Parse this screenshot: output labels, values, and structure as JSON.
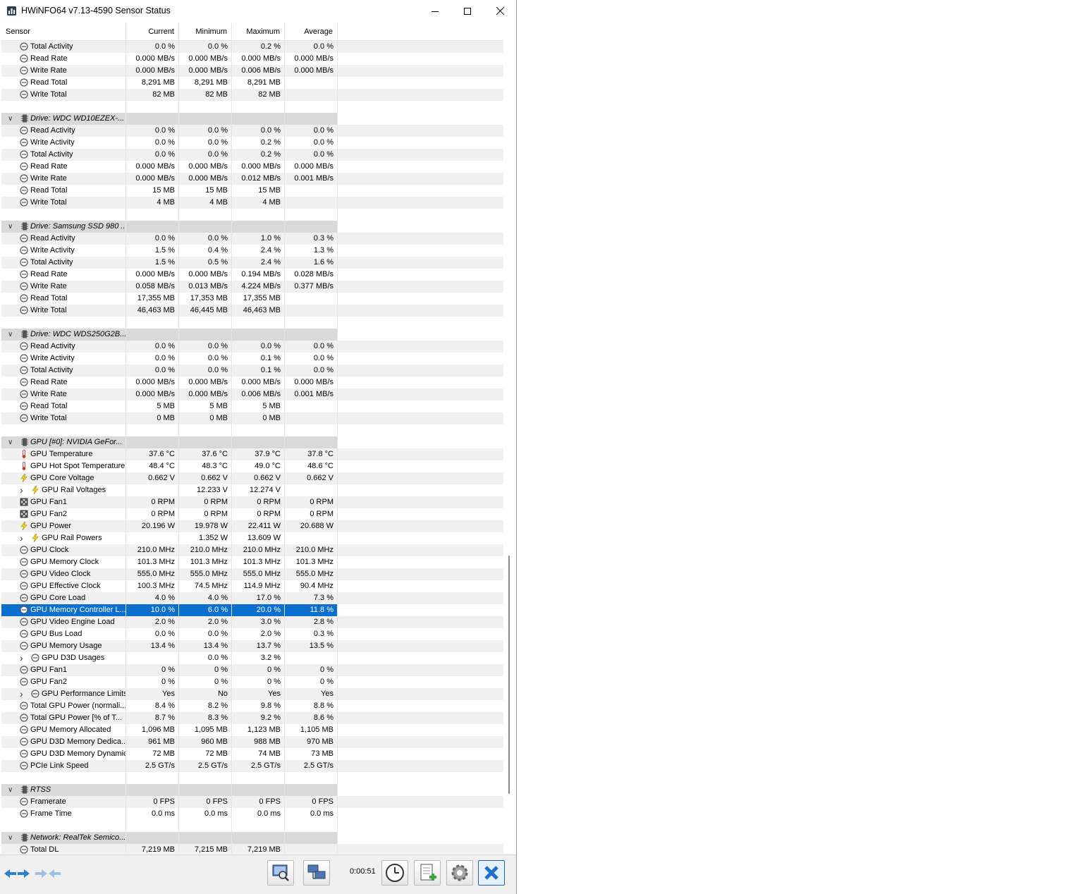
{
  "window": {
    "title": "HWiNFO64 v7.13-4590 Sensor Status"
  },
  "columns": [
    "Sensor",
    "Current",
    "Minimum",
    "Maximum",
    "Average"
  ],
  "rows": [
    {
      "t": "s",
      "i": "clock",
      "l": "Total Activity",
      "v": [
        "0.0 %",
        "0.0 %",
        "0.2 %",
        "0.0 %"
      ]
    },
    {
      "t": "s",
      "i": "clock",
      "l": "Read Rate",
      "v": [
        "0.000 MB/s",
        "0.000 MB/s",
        "0.000 MB/s",
        "0.000 MB/s"
      ]
    },
    {
      "t": "s",
      "i": "clock",
      "l": "Write Rate",
      "v": [
        "0.000 MB/s",
        "0.000 MB/s",
        "0.006 MB/s",
        "0.000 MB/s"
      ]
    },
    {
      "t": "s",
      "i": "clock",
      "l": "Read Total",
      "v": [
        "8,291 MB",
        "8,291 MB",
        "8,291 MB",
        ""
      ]
    },
    {
      "t": "s",
      "i": "clock",
      "l": "Write Total",
      "v": [
        "82 MB",
        "82 MB",
        "82 MB",
        ""
      ]
    },
    {
      "t": "b"
    },
    {
      "t": "g",
      "l": "Drive: WDC WD10EZEX-..."
    },
    {
      "t": "s",
      "i": "clock",
      "l": "Read Activity",
      "v": [
        "0.0 %",
        "0.0 %",
        "0.0 %",
        "0.0 %"
      ]
    },
    {
      "t": "s",
      "i": "clock",
      "l": "Write Activity",
      "v": [
        "0.0 %",
        "0.0 %",
        "0.2 %",
        "0.0 %"
      ]
    },
    {
      "t": "s",
      "i": "clock",
      "l": "Total Activity",
      "v": [
        "0.0 %",
        "0.0 %",
        "0.2 %",
        "0.0 %"
      ]
    },
    {
      "t": "s",
      "i": "clock",
      "l": "Read Rate",
      "v": [
        "0.000 MB/s",
        "0.000 MB/s",
        "0.000 MB/s",
        "0.000 MB/s"
      ]
    },
    {
      "t": "s",
      "i": "clock",
      "l": "Write Rate",
      "v": [
        "0.000 MB/s",
        "0.000 MB/s",
        "0.012 MB/s",
        "0.001 MB/s"
      ]
    },
    {
      "t": "s",
      "i": "clock",
      "l": "Read Total",
      "v": [
        "15 MB",
        "15 MB",
        "15 MB",
        ""
      ]
    },
    {
      "t": "s",
      "i": "clock",
      "l": "Write Total",
      "v": [
        "4 MB",
        "4 MB",
        "4 MB",
        ""
      ]
    },
    {
      "t": "b"
    },
    {
      "t": "g",
      "l": "Drive: Samsung SSD 980 ..."
    },
    {
      "t": "s",
      "i": "clock",
      "l": "Read Activity",
      "v": [
        "0.0 %",
        "0.0 %",
        "1.0 %",
        "0.3 %"
      ]
    },
    {
      "t": "s",
      "i": "clock",
      "l": "Write Activity",
      "v": [
        "1.5 %",
        "0.4 %",
        "2.4 %",
        "1.3 %"
      ]
    },
    {
      "t": "s",
      "i": "clock",
      "l": "Total Activity",
      "v": [
        "1.5 %",
        "0.5 %",
        "2.4 %",
        "1.6 %"
      ]
    },
    {
      "t": "s",
      "i": "clock",
      "l": "Read Rate",
      "v": [
        "0.000 MB/s",
        "0.000 MB/s",
        "0.194 MB/s",
        "0.028 MB/s"
      ]
    },
    {
      "t": "s",
      "i": "clock",
      "l": "Write Rate",
      "v": [
        "0.058 MB/s",
        "0.013 MB/s",
        "4.224 MB/s",
        "0.377 MB/s"
      ]
    },
    {
      "t": "s",
      "i": "clock",
      "l": "Read Total",
      "v": [
        "17,355 MB",
        "17,353 MB",
        "17,355 MB",
        ""
      ]
    },
    {
      "t": "s",
      "i": "clock",
      "l": "Write Total",
      "v": [
        "46,463 MB",
        "46,445 MB",
        "46,463 MB",
        ""
      ]
    },
    {
      "t": "b"
    },
    {
      "t": "g",
      "l": "Drive: WDC WDS250G2B..."
    },
    {
      "t": "s",
      "i": "clock",
      "l": "Read Activity",
      "v": [
        "0.0 %",
        "0.0 %",
        "0.0 %",
        "0.0 %"
      ]
    },
    {
      "t": "s",
      "i": "clock",
      "l": "Write Activity",
      "v": [
        "0.0 %",
        "0.0 %",
        "0.1 %",
        "0.0 %"
      ]
    },
    {
      "t": "s",
      "i": "clock",
      "l": "Total Activity",
      "v": [
        "0.0 %",
        "0.0 %",
        "0.1 %",
        "0.0 %"
      ]
    },
    {
      "t": "s",
      "i": "clock",
      "l": "Read Rate",
      "v": [
        "0.000 MB/s",
        "0.000 MB/s",
        "0.000 MB/s",
        "0.000 MB/s"
      ]
    },
    {
      "t": "s",
      "i": "clock",
      "l": "Write Rate",
      "v": [
        "0.000 MB/s",
        "0.000 MB/s",
        "0.006 MB/s",
        "0.001 MB/s"
      ]
    },
    {
      "t": "s",
      "i": "clock",
      "l": "Read Total",
      "v": [
        "5 MB",
        "5 MB",
        "5 MB",
        ""
      ]
    },
    {
      "t": "s",
      "i": "clock",
      "l": "Write Total",
      "v": [
        "0 MB",
        "0 MB",
        "0 MB",
        ""
      ]
    },
    {
      "t": "b"
    },
    {
      "t": "g",
      "l": "GPU [#0]: NVIDIA GeFor..."
    },
    {
      "t": "s",
      "i": "thermometer",
      "l": "GPU Temperature",
      "v": [
        "37.6 °C",
        "37.6 °C",
        "37.9 °C",
        "37.8 °C"
      ]
    },
    {
      "t": "s",
      "i": "thermometer",
      "l": "GPU Hot Spot Temperature",
      "v": [
        "48.4 °C",
        "48.3 °C",
        "49.0 °C",
        "48.6 °C"
      ]
    },
    {
      "t": "s",
      "i": "bolt",
      "l": "GPU Core Voltage",
      "v": [
        "0.662 V",
        "0.662 V",
        "0.662 V",
        "0.662 V"
      ]
    },
    {
      "t": "x",
      "i": "bolt",
      "l": "GPU Rail Voltages",
      "v": [
        "",
        "12.233 V",
        "12.274 V",
        ""
      ]
    },
    {
      "t": "s",
      "i": "fan",
      "l": "GPU Fan1",
      "v": [
        "0 RPM",
        "0 RPM",
        "0 RPM",
        "0 RPM"
      ]
    },
    {
      "t": "s",
      "i": "fan",
      "l": "GPU Fan2",
      "v": [
        "0 RPM",
        "0 RPM",
        "0 RPM",
        "0 RPM"
      ]
    },
    {
      "t": "s",
      "i": "bolt",
      "l": "GPU Power",
      "v": [
        "20.196 W",
        "19.978 W",
        "22.411 W",
        "20.688 W"
      ]
    },
    {
      "t": "x",
      "i": "bolt",
      "l": "GPU Rail Powers",
      "v": [
        "",
        "1.352 W",
        "13.609 W",
        ""
      ]
    },
    {
      "t": "s",
      "i": "clock",
      "l": "GPU Clock",
      "v": [
        "210.0 MHz",
        "210.0 MHz",
        "210.0 MHz",
        "210.0 MHz"
      ]
    },
    {
      "t": "s",
      "i": "clock",
      "l": "GPU Memory Clock",
      "v": [
        "101.3 MHz",
        "101.3 MHz",
        "101.3 MHz",
        "101.3 MHz"
      ]
    },
    {
      "t": "s",
      "i": "clock",
      "l": "GPU Video Clock",
      "v": [
        "555.0 MHz",
        "555.0 MHz",
        "555.0 MHz",
        "555.0 MHz"
      ]
    },
    {
      "t": "s",
      "i": "clock",
      "l": "GPU Effective Clock",
      "v": [
        "100.3 MHz",
        "74.5 MHz",
        "114.9 MHz",
        "90.4 MHz"
      ]
    },
    {
      "t": "s",
      "i": "clock",
      "l": "GPU Core Load",
      "v": [
        "4.0 %",
        "4.0 %",
        "17.0 %",
        "7.3 %"
      ]
    },
    {
      "t": "s",
      "i": "clock",
      "l": "GPU Memory Controller L...",
      "v": [
        "10.0 %",
        "6.0 %",
        "20.0 %",
        "11.8 %"
      ],
      "sel": true
    },
    {
      "t": "s",
      "i": "clock",
      "l": "GPU Video Engine Load",
      "v": [
        "2.0 %",
        "2.0 %",
        "3.0 %",
        "2.8 %"
      ]
    },
    {
      "t": "s",
      "i": "clock",
      "l": "GPU Bus Load",
      "v": [
        "0.0 %",
        "0.0 %",
        "2.0 %",
        "0.3 %"
      ]
    },
    {
      "t": "s",
      "i": "clock",
      "l": "GPU Memory Usage",
      "v": [
        "13.4 %",
        "13.4 %",
        "13.7 %",
        "13.5 %"
      ]
    },
    {
      "t": "x",
      "i": "clock",
      "l": "GPU D3D Usages",
      "v": [
        "",
        "0.0 %",
        "3.2 %",
        ""
      ]
    },
    {
      "t": "s",
      "i": "clock",
      "l": "GPU Fan1",
      "v": [
        "0 %",
        "0 %",
        "0 %",
        "0 %"
      ]
    },
    {
      "t": "s",
      "i": "clock",
      "l": "GPU Fan2",
      "v": [
        "0 %",
        "0 %",
        "0 %",
        "0 %"
      ]
    },
    {
      "t": "x",
      "i": "clock",
      "l": "GPU Performance Limits",
      "v": [
        "Yes",
        "No",
        "Yes",
        "Yes"
      ]
    },
    {
      "t": "s",
      "i": "clock",
      "l": "Total GPU Power (normali...",
      "v": [
        "8.4 %",
        "8.2 %",
        "9.8 %",
        "8.8 %"
      ]
    },
    {
      "t": "s",
      "i": "clock",
      "l": "Total GPU Power [% of T...",
      "v": [
        "8.7 %",
        "8.3 %",
        "9.2 %",
        "8.6 %"
      ]
    },
    {
      "t": "s",
      "i": "clock",
      "l": "GPU Memory Allocated",
      "v": [
        "1,096 MB",
        "1,095 MB",
        "1,123 MB",
        "1,105 MB"
      ]
    },
    {
      "t": "s",
      "i": "clock",
      "l": "GPU D3D Memory Dedica...",
      "v": [
        "961 MB",
        "960 MB",
        "988 MB",
        "970 MB"
      ]
    },
    {
      "t": "s",
      "i": "clock",
      "l": "GPU D3D Memory Dynamic",
      "v": [
        "72 MB",
        "72 MB",
        "74 MB",
        "73 MB"
      ]
    },
    {
      "t": "s",
      "i": "clock",
      "l": "PCIe Link Speed",
      "v": [
        "2.5 GT/s",
        "2.5 GT/s",
        "2.5 GT/s",
        "2.5 GT/s"
      ]
    },
    {
      "t": "b"
    },
    {
      "t": "g",
      "l": "RTSS"
    },
    {
      "t": "s",
      "i": "clock",
      "l": "Framerate",
      "v": [
        "0 FPS",
        "0 FPS",
        "0 FPS",
        "0 FPS"
      ]
    },
    {
      "t": "s",
      "i": "clock",
      "l": "Frame Time",
      "v": [
        "0.0 ms",
        "0.0 ms",
        "0.0 ms",
        "0.0 ms"
      ]
    },
    {
      "t": "b"
    },
    {
      "t": "g",
      "l": "Network: RealTek Semico..."
    },
    {
      "t": "s",
      "i": "clock",
      "l": "Total DL",
      "v": [
        "7,219 MB",
        "7,215 MB",
        "7,219 MB",
        ""
      ]
    }
  ],
  "toolbar": {
    "timer": "0:00:51",
    "buttons": [
      "nav-arrows",
      "nav-arrows-disabled",
      "report",
      "network",
      "clock-reset",
      "add-log",
      "settings",
      "close"
    ]
  },
  "colors": {
    "selection": "#0b6fd0",
    "group_bg": "#d9d9d9",
    "stripe_bg": "#f0f0f0"
  }
}
